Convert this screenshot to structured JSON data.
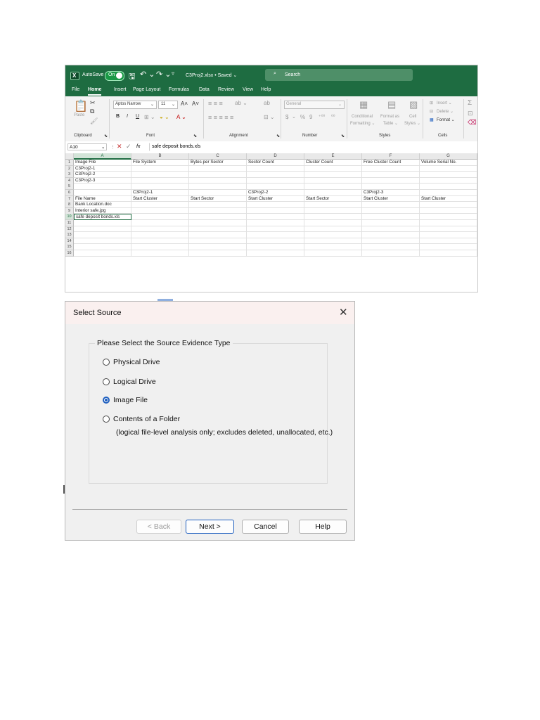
{
  "excel": {
    "titlebar": {
      "autosave_label": "AutoSave",
      "autosave_state": "On",
      "filename": "C3Proj2.xlsx • Saved ⌄",
      "search_placeholder": "Search",
      "save_icon": "save-icon",
      "undo_icon": "undo-icon",
      "redo_icon": "redo-icon"
    },
    "menu": [
      "File",
      "Home",
      "Insert",
      "Page Layout",
      "Formulas",
      "Data",
      "Review",
      "View",
      "Help"
    ],
    "menu_active": "Home",
    "ribbon": {
      "clipboard": {
        "paste": "Paste",
        "group": "Clipboard"
      },
      "font": {
        "name": "Aptos Narrow",
        "size": "11",
        "bold": "B",
        "italic": "I",
        "underline": "U",
        "group": "Font"
      },
      "alignment": {
        "group": "Alignment"
      },
      "number": {
        "format": "General",
        "currency": "$",
        "percent": "%",
        "comma": "9",
        "group": "Number"
      },
      "styles": {
        "conditional": "Conditional",
        "formatting": "Formatting ⌄",
        "format_as": "Format as",
        "table": "Table ⌄",
        "cell": "Cell",
        "cell_styles": "Styles ⌄",
        "group": "Styles"
      },
      "cells": {
        "insert": "Insert ⌄",
        "delete": "Delete ⌄",
        "format": "Format ⌄",
        "group": "Cells"
      }
    },
    "formula_bar": {
      "cell_ref": "A10",
      "fx": "fx",
      "content": "safe deposit bonds.xls"
    },
    "columns": [
      "A",
      "B",
      "C",
      "D",
      "E",
      "F",
      "G"
    ],
    "selected_column": "A",
    "rows": [
      {
        "n": "1",
        "cells": [
          "Image File",
          "File System",
          "Bytes per Sector",
          "Sector Count",
          "Cluster Count",
          "Free Cluster Count",
          "Volume Serial No."
        ]
      },
      {
        "n": "2",
        "cells": [
          "C3Proj2-1",
          "",
          "",
          "",
          "",
          "",
          ""
        ]
      },
      {
        "n": "3",
        "cells": [
          "C3Proj2-2",
          "",
          "",
          "",
          "",
          "",
          ""
        ]
      },
      {
        "n": "4",
        "cells": [
          "C3Proj2-3",
          "",
          "",
          "",
          "",
          "",
          ""
        ]
      },
      {
        "n": "5",
        "cells": [
          "",
          "",
          "",
          "",
          "",
          "",
          ""
        ]
      },
      {
        "n": "6",
        "cells": [
          "",
          "C3Proj2-1",
          "",
          "C3Proj2-2",
          "",
          "C3Proj2-3",
          ""
        ]
      },
      {
        "n": "7",
        "cells": [
          "File Name",
          "Start Cluster",
          "Start Sector",
          "Start Cluster",
          "Start Sector",
          "Start Cluster",
          "Start Cluster"
        ]
      },
      {
        "n": "8",
        "cells": [
          "Bank Location.doc",
          "",
          "",
          "",
          "",
          "",
          ""
        ]
      },
      {
        "n": "9",
        "cells": [
          "Interior safe.jpg",
          "",
          "",
          "",
          "",
          "",
          ""
        ]
      },
      {
        "n": "10",
        "cells": [
          "safe deposit bonds.xls",
          "",
          "",
          "",
          "",
          "",
          ""
        ]
      },
      {
        "n": "11",
        "cells": [
          "",
          "",
          "",
          "",
          "",
          "",
          ""
        ]
      },
      {
        "n": "12",
        "cells": [
          "",
          "",
          "",
          "",
          "",
          "",
          ""
        ]
      },
      {
        "n": "13",
        "cells": [
          "",
          "",
          "",
          "",
          "",
          "",
          ""
        ]
      },
      {
        "n": "14",
        "cells": [
          "",
          "",
          "",
          "",
          "",
          "",
          ""
        ]
      },
      {
        "n": "15",
        "cells": [
          "",
          "",
          "",
          "",
          "",
          "",
          ""
        ]
      },
      {
        "n": "16",
        "cells": [
          "",
          "",
          "",
          "",
          "",
          "",
          ""
        ]
      }
    ],
    "active_row": "10",
    "accent_color": "#1e6c41"
  },
  "dialog": {
    "title": "Select Source",
    "close_icon": "close-icon",
    "group_label": "Please Select the Source Evidence Type",
    "options": [
      {
        "label": "Physical Drive",
        "checked": false
      },
      {
        "label": "Logical Drive",
        "checked": false
      },
      {
        "label": "Image File",
        "checked": true
      },
      {
        "label": "Contents of a Folder",
        "checked": false
      }
    ],
    "folder_note": "(logical file-level analysis only; excludes deleted, unallocated, etc.)",
    "buttons": {
      "back": "< Back",
      "next": "Next >",
      "cancel": "Cancel",
      "help": "Help"
    },
    "selected_color": "#1f5fbf"
  }
}
